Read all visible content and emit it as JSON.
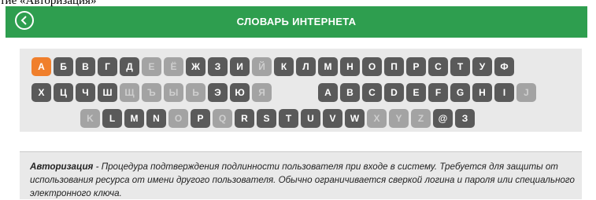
{
  "top_caption": "тие «Авторизация»",
  "header": {
    "title": "СЛОВАРЬ ИНТЕРНЕТА",
    "back_icon": "chevron-left-icon",
    "color": "#2e9e4f"
  },
  "keyboard": {
    "active_color": "#f07f2c",
    "row1": [
      {
        "label": "А",
        "state": "active"
      },
      {
        "label": "Б",
        "state": "on"
      },
      {
        "label": "В",
        "state": "on"
      },
      {
        "label": "Г",
        "state": "on"
      },
      {
        "label": "Д",
        "state": "on"
      },
      {
        "label": "Е",
        "state": "off"
      },
      {
        "label": "Ё",
        "state": "off"
      },
      {
        "label": "Ж",
        "state": "on"
      },
      {
        "label": "З",
        "state": "on"
      },
      {
        "label": "И",
        "state": "on"
      },
      {
        "label": "Й",
        "state": "off"
      },
      {
        "label": "К",
        "state": "on"
      },
      {
        "label": "Л",
        "state": "on"
      },
      {
        "label": "М",
        "state": "on"
      },
      {
        "label": "Н",
        "state": "on"
      },
      {
        "label": "О",
        "state": "on"
      },
      {
        "label": "П",
        "state": "on"
      },
      {
        "label": "Р",
        "state": "on"
      },
      {
        "label": "С",
        "state": "on"
      },
      {
        "label": "Т",
        "state": "on"
      },
      {
        "label": "У",
        "state": "on"
      },
      {
        "label": "Ф",
        "state": "on"
      }
    ],
    "row2": [
      {
        "label": "Х",
        "state": "on"
      },
      {
        "label": "Ц",
        "state": "on"
      },
      {
        "label": "Ч",
        "state": "on"
      },
      {
        "label": "Ш",
        "state": "on"
      },
      {
        "label": "Щ",
        "state": "off"
      },
      {
        "label": "Ъ",
        "state": "off"
      },
      {
        "label": "Ы",
        "state": "off"
      },
      {
        "label": "Ь",
        "state": "off"
      },
      {
        "label": "Э",
        "state": "on"
      },
      {
        "label": "Ю",
        "state": "on"
      },
      {
        "label": "Я",
        "state": "off"
      },
      {
        "label": "",
        "state": "gap"
      },
      {
        "label": "",
        "state": "gap"
      },
      {
        "label": "A",
        "state": "on"
      },
      {
        "label": "B",
        "state": "on"
      },
      {
        "label": "C",
        "state": "on"
      },
      {
        "label": "D",
        "state": "on"
      },
      {
        "label": "E",
        "state": "on"
      },
      {
        "label": "F",
        "state": "on"
      },
      {
        "label": "G",
        "state": "on"
      },
      {
        "label": "H",
        "state": "on"
      },
      {
        "label": "I",
        "state": "on"
      },
      {
        "label": "J",
        "state": "off"
      }
    ],
    "row3": [
      {
        "label": "K",
        "state": "off"
      },
      {
        "label": "L",
        "state": "on"
      },
      {
        "label": "M",
        "state": "on"
      },
      {
        "label": "N",
        "state": "on"
      },
      {
        "label": "O",
        "state": "off"
      },
      {
        "label": "P",
        "state": "on"
      },
      {
        "label": "Q",
        "state": "off"
      },
      {
        "label": "R",
        "state": "on"
      },
      {
        "label": "S",
        "state": "on"
      },
      {
        "label": "T",
        "state": "on"
      },
      {
        "label": "U",
        "state": "on"
      },
      {
        "label": "V",
        "state": "on"
      },
      {
        "label": "W",
        "state": "on"
      },
      {
        "label": "X",
        "state": "off"
      },
      {
        "label": "Y",
        "state": "off"
      },
      {
        "label": "Z",
        "state": "off"
      },
      {
        "label": "@",
        "state": "on"
      },
      {
        "label": "З",
        "state": "on"
      }
    ]
  },
  "definition": {
    "term": "Авторизация",
    "text": " - Процедура подтверждения подлинности пользователя при входе в систему. Требуется для защиты от использования ресурса от имени другого пользователя. Обычно ограничивается сверкой логина и пароля или специального электронного ключа."
  }
}
